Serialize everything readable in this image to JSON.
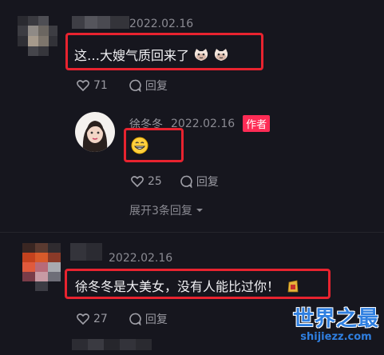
{
  "comment1": {
    "date": "2022.02.16",
    "text": "这…大嫂气质回来了",
    "likes": "71",
    "reply_label": "回复"
  },
  "reply1": {
    "username": "徐冬冬",
    "date": "2022.02.16",
    "author_tag": "作者",
    "likes": "25",
    "reply_label": "回复",
    "expand_label": "展开3条回复"
  },
  "comment2": {
    "date": "2022.02.16",
    "text": "徐冬冬是大美女，没有人能比过你！",
    "likes": "27",
    "reply_label": "回复"
  },
  "watermark": {
    "title": "世界之最",
    "url": "shijiezz.com"
  }
}
